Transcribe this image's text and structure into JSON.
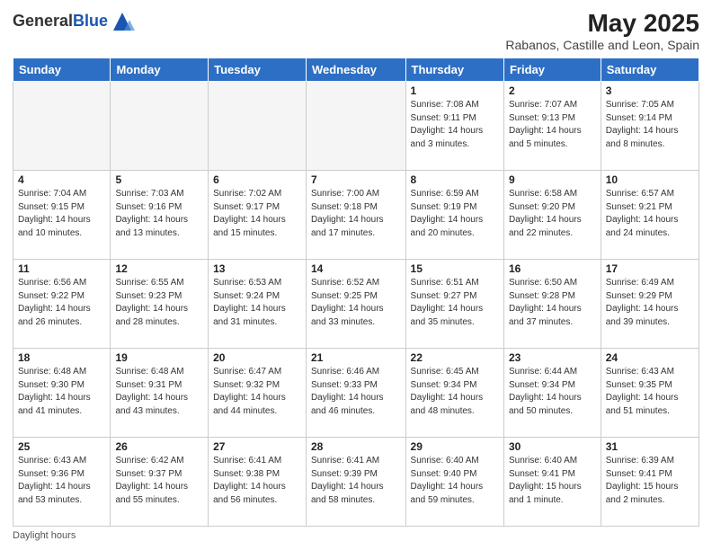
{
  "logo": {
    "general": "General",
    "blue": "Blue"
  },
  "header": {
    "title": "May 2025",
    "subtitle": "Rabanos, Castille and Leon, Spain"
  },
  "days_of_week": [
    "Sunday",
    "Monday",
    "Tuesday",
    "Wednesday",
    "Thursday",
    "Friday",
    "Saturday"
  ],
  "footer": {
    "daylight_label": "Daylight hours"
  },
  "weeks": [
    [
      {
        "day": "",
        "empty": true
      },
      {
        "day": "",
        "empty": true
      },
      {
        "day": "",
        "empty": true
      },
      {
        "day": "",
        "empty": true
      },
      {
        "day": "1",
        "sunrise": "Sunrise: 7:08 AM",
        "sunset": "Sunset: 9:11 PM",
        "daylight": "Daylight: 14 hours and 3 minutes."
      },
      {
        "day": "2",
        "sunrise": "Sunrise: 7:07 AM",
        "sunset": "Sunset: 9:13 PM",
        "daylight": "Daylight: 14 hours and 5 minutes."
      },
      {
        "day": "3",
        "sunrise": "Sunrise: 7:05 AM",
        "sunset": "Sunset: 9:14 PM",
        "daylight": "Daylight: 14 hours and 8 minutes."
      }
    ],
    [
      {
        "day": "4",
        "sunrise": "Sunrise: 7:04 AM",
        "sunset": "Sunset: 9:15 PM",
        "daylight": "Daylight: 14 hours and 10 minutes."
      },
      {
        "day": "5",
        "sunrise": "Sunrise: 7:03 AM",
        "sunset": "Sunset: 9:16 PM",
        "daylight": "Daylight: 14 hours and 13 minutes."
      },
      {
        "day": "6",
        "sunrise": "Sunrise: 7:02 AM",
        "sunset": "Sunset: 9:17 PM",
        "daylight": "Daylight: 14 hours and 15 minutes."
      },
      {
        "day": "7",
        "sunrise": "Sunrise: 7:00 AM",
        "sunset": "Sunset: 9:18 PM",
        "daylight": "Daylight: 14 hours and 17 minutes."
      },
      {
        "day": "8",
        "sunrise": "Sunrise: 6:59 AM",
        "sunset": "Sunset: 9:19 PM",
        "daylight": "Daylight: 14 hours and 20 minutes."
      },
      {
        "day": "9",
        "sunrise": "Sunrise: 6:58 AM",
        "sunset": "Sunset: 9:20 PM",
        "daylight": "Daylight: 14 hours and 22 minutes."
      },
      {
        "day": "10",
        "sunrise": "Sunrise: 6:57 AM",
        "sunset": "Sunset: 9:21 PM",
        "daylight": "Daylight: 14 hours and 24 minutes."
      }
    ],
    [
      {
        "day": "11",
        "sunrise": "Sunrise: 6:56 AM",
        "sunset": "Sunset: 9:22 PM",
        "daylight": "Daylight: 14 hours and 26 minutes."
      },
      {
        "day": "12",
        "sunrise": "Sunrise: 6:55 AM",
        "sunset": "Sunset: 9:23 PM",
        "daylight": "Daylight: 14 hours and 28 minutes."
      },
      {
        "day": "13",
        "sunrise": "Sunrise: 6:53 AM",
        "sunset": "Sunset: 9:24 PM",
        "daylight": "Daylight: 14 hours and 31 minutes."
      },
      {
        "day": "14",
        "sunrise": "Sunrise: 6:52 AM",
        "sunset": "Sunset: 9:25 PM",
        "daylight": "Daylight: 14 hours and 33 minutes."
      },
      {
        "day": "15",
        "sunrise": "Sunrise: 6:51 AM",
        "sunset": "Sunset: 9:27 PM",
        "daylight": "Daylight: 14 hours and 35 minutes."
      },
      {
        "day": "16",
        "sunrise": "Sunrise: 6:50 AM",
        "sunset": "Sunset: 9:28 PM",
        "daylight": "Daylight: 14 hours and 37 minutes."
      },
      {
        "day": "17",
        "sunrise": "Sunrise: 6:49 AM",
        "sunset": "Sunset: 9:29 PM",
        "daylight": "Daylight: 14 hours and 39 minutes."
      }
    ],
    [
      {
        "day": "18",
        "sunrise": "Sunrise: 6:48 AM",
        "sunset": "Sunset: 9:30 PM",
        "daylight": "Daylight: 14 hours and 41 minutes."
      },
      {
        "day": "19",
        "sunrise": "Sunrise: 6:48 AM",
        "sunset": "Sunset: 9:31 PM",
        "daylight": "Daylight: 14 hours and 43 minutes."
      },
      {
        "day": "20",
        "sunrise": "Sunrise: 6:47 AM",
        "sunset": "Sunset: 9:32 PM",
        "daylight": "Daylight: 14 hours and 44 minutes."
      },
      {
        "day": "21",
        "sunrise": "Sunrise: 6:46 AM",
        "sunset": "Sunset: 9:33 PM",
        "daylight": "Daylight: 14 hours and 46 minutes."
      },
      {
        "day": "22",
        "sunrise": "Sunrise: 6:45 AM",
        "sunset": "Sunset: 9:34 PM",
        "daylight": "Daylight: 14 hours and 48 minutes."
      },
      {
        "day": "23",
        "sunrise": "Sunrise: 6:44 AM",
        "sunset": "Sunset: 9:34 PM",
        "daylight": "Daylight: 14 hours and 50 minutes."
      },
      {
        "day": "24",
        "sunrise": "Sunrise: 6:43 AM",
        "sunset": "Sunset: 9:35 PM",
        "daylight": "Daylight: 14 hours and 51 minutes."
      }
    ],
    [
      {
        "day": "25",
        "sunrise": "Sunrise: 6:43 AM",
        "sunset": "Sunset: 9:36 PM",
        "daylight": "Daylight: 14 hours and 53 minutes."
      },
      {
        "day": "26",
        "sunrise": "Sunrise: 6:42 AM",
        "sunset": "Sunset: 9:37 PM",
        "daylight": "Daylight: 14 hours and 55 minutes."
      },
      {
        "day": "27",
        "sunrise": "Sunrise: 6:41 AM",
        "sunset": "Sunset: 9:38 PM",
        "daylight": "Daylight: 14 hours and 56 minutes."
      },
      {
        "day": "28",
        "sunrise": "Sunrise: 6:41 AM",
        "sunset": "Sunset: 9:39 PM",
        "daylight": "Daylight: 14 hours and 58 minutes."
      },
      {
        "day": "29",
        "sunrise": "Sunrise: 6:40 AM",
        "sunset": "Sunset: 9:40 PM",
        "daylight": "Daylight: 14 hours and 59 minutes."
      },
      {
        "day": "30",
        "sunrise": "Sunrise: 6:40 AM",
        "sunset": "Sunset: 9:41 PM",
        "daylight": "Daylight: 15 hours and 1 minute."
      },
      {
        "day": "31",
        "sunrise": "Sunrise: 6:39 AM",
        "sunset": "Sunset: 9:41 PM",
        "daylight": "Daylight: 15 hours and 2 minutes."
      }
    ]
  ]
}
